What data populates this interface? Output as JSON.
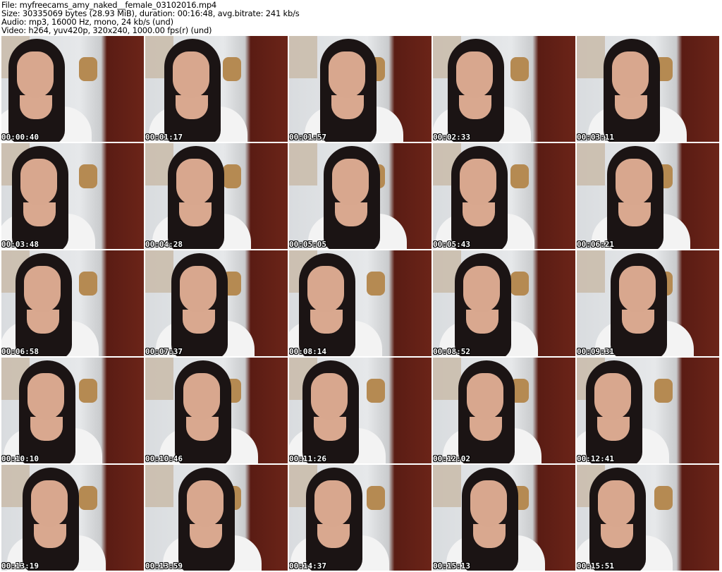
{
  "info": {
    "file": "File: myfreecams_amy_naked__female_03102016.mp4",
    "size": "Size: 30335069 bytes (28.93 MiB), duration: 00:16:48, avg.bitrate: 241 kb/s",
    "audio": "Audio: mp3, 16000 Hz, mono, 24 kb/s (und)",
    "video": "Video: h264, yuv420p, 320x240, 1000.00 fps(r) (und)"
  },
  "thumbnails": [
    "00:00:40",
    "00:01:17",
    "00:01:57",
    "00:02:33",
    "00:03:11",
    "00:03:48",
    "00:04:28",
    "00:05:05",
    "00:05:43",
    "00:06:21",
    "00:06:58",
    "00:07:37",
    "00:08:14",
    "00:08:52",
    "00:09:31",
    "00:10:10",
    "00:10:46",
    "00:11:26",
    "00:12:02",
    "00:12:41",
    "00:13:19",
    "00:13:59",
    "00:14:37",
    "00:15:13",
    "00:15:51"
  ]
}
